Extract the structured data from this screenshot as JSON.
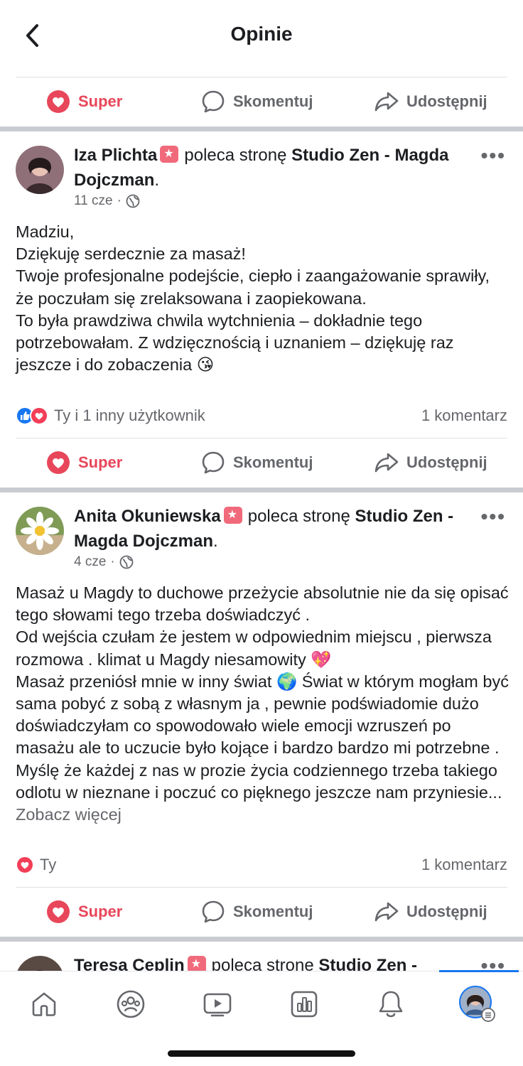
{
  "header": {
    "title": "Opinie",
    "back_icon": "chevron-left-icon"
  },
  "actions": {
    "super": "Super",
    "comment": "Skomentuj",
    "share": "Udostępnij"
  },
  "colors": {
    "super": "#e8465a",
    "like": "#1877f2",
    "love": "#f33e58",
    "separator": "#c9ccd1"
  },
  "posts": [
    {
      "name": "Iza Plichta",
      "verb": "poleca stronę",
      "page": "Studio Zen - Magda Dojczman",
      "period": ".",
      "date": "11 cze",
      "privacy_icon": "globe-icon",
      "text": "Madziu,\nDziękuję serdecznie za masaż!\nTwoje profesjonalne podejście, ciepło i zaangażowanie sprawiły, że poczułam  się zrelaksowana i zaopiekowana.\nTo była prawdziwa chwila wytchnienia – dokładnie tego potrzebowałam. Z wdzięcznością i uznaniem – dziękuję raz jeszcze i do zobaczenia 😘",
      "reactions": "Ty i 1 inny użytkownik",
      "comments": "1 komentarz"
    },
    {
      "name": "Anita Okuniewska",
      "verb": "poleca stronę",
      "page": "Studio Zen - Magda Dojczman",
      "period": ".",
      "date": "4 cze",
      "privacy_icon": "globe-icon",
      "text": "Masaż u Magdy to duchowe przeżycie absolutnie nie da się opisać tego słowami tego trzeba doświadczyć .\nOd wejścia czułam że jestem w odpowiednim miejscu , pierwsza rozmowa . klimat u Magdy niesamowity 💖\nMasaż przeniósł mnie w inny świat 🌍 Świat w którym mogłam być sama pobyć z sobą z własnym ja , pewnie podświadomie dużo doświadczyłam co spowodowało wiele emocji wzruszeń po masażu  ale to uczucie było kojące i bardzo bardzo mi potrzebne .\nMyślę że każdej z nas w prozie życia codziennego trzeba takiego odlotu w nieznane i poczuć co pięknego jeszcze nam przyniesie...",
      "see_more": "Zobacz więcej",
      "reactions": "Ty",
      "comments": "1 komentarz"
    },
    {
      "name": "Teresa Ceplin",
      "verb": "poleca strone",
      "page": "Studio Zen -"
    }
  ],
  "tabbar": [
    "home-icon",
    "groups-icon",
    "video-icon",
    "dashboard-icon",
    "bell-icon",
    "profile-avatar"
  ]
}
